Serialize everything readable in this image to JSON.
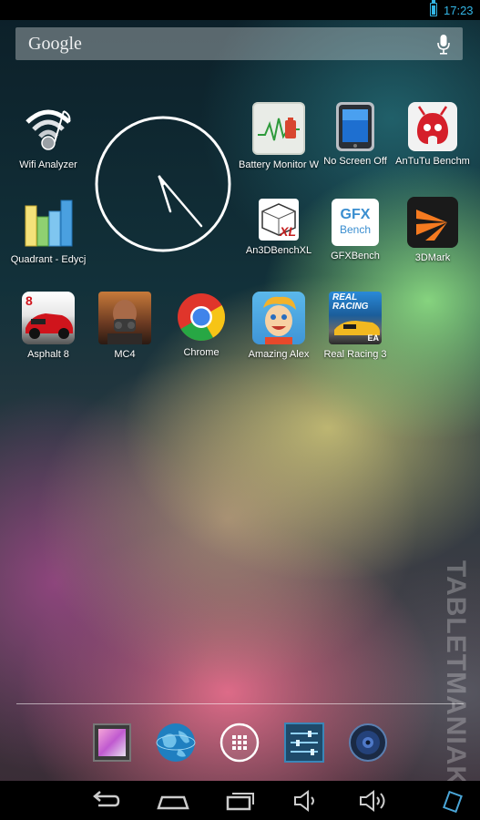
{
  "status_bar": {
    "time": "17:23",
    "battery_icon": "battery-icon"
  },
  "search": {
    "label": "Google",
    "mic_icon": "mic-icon"
  },
  "apps": [
    {
      "label": "Wifi Analyzer",
      "icon": "wifi-analyzer-icon"
    },
    {
      "label": "Battery Monitor W",
      "icon": "battery-monitor-icon"
    },
    {
      "label": "No Screen Off",
      "icon": "no-screen-off-icon"
    },
    {
      "label": "AnTuTu Benchm",
      "icon": "antutu-icon"
    },
    {
      "label": "Quadrant - Edycj",
      "icon": "quadrant-icon"
    },
    {
      "label": "An3DBenchXL",
      "icon": "an3dbenchxl-icon",
      "icon_text": "XL"
    },
    {
      "label": "GFXBench",
      "icon": "gfxbench-icon",
      "icon_text_1": "GFX",
      "icon_text_2": "Bench"
    },
    {
      "label": "3DMark",
      "icon": "3dmark-icon"
    },
    {
      "label": "Asphalt 8",
      "icon": "asphalt-8-icon",
      "icon_text": "8"
    },
    {
      "label": "MC4",
      "icon": "mc4-icon"
    },
    {
      "label": "Chrome",
      "icon": "chrome-icon"
    },
    {
      "label": "Amazing Alex",
      "icon": "amazing-alex-icon"
    },
    {
      "label": "Real Racing 3",
      "icon": "real-racing-3-icon",
      "icon_text_1": "REAL",
      "icon_text_2": "RACING",
      "icon_text_3": "EA"
    }
  ],
  "clock_widget": {
    "icon": "analog-clock-icon"
  },
  "dock": [
    {
      "icon": "gallery-icon"
    },
    {
      "icon": "browser-globe-icon"
    },
    {
      "icon": "all-apps-icon"
    },
    {
      "icon": "settings-icon"
    },
    {
      "icon": "music-speaker-icon"
    }
  ],
  "nav_bar": [
    {
      "icon": "back-icon"
    },
    {
      "icon": "home-icon"
    },
    {
      "icon": "recent-apps-icon"
    },
    {
      "icon": "volume-down-icon"
    },
    {
      "icon": "volume-up-icon"
    },
    {
      "icon": "screenshot-icon"
    }
  ],
  "watermark": {
    "text": "TABLETMANIAK"
  },
  "colors": {
    "accent": "#33b5e5",
    "statusbar": "#000000"
  }
}
